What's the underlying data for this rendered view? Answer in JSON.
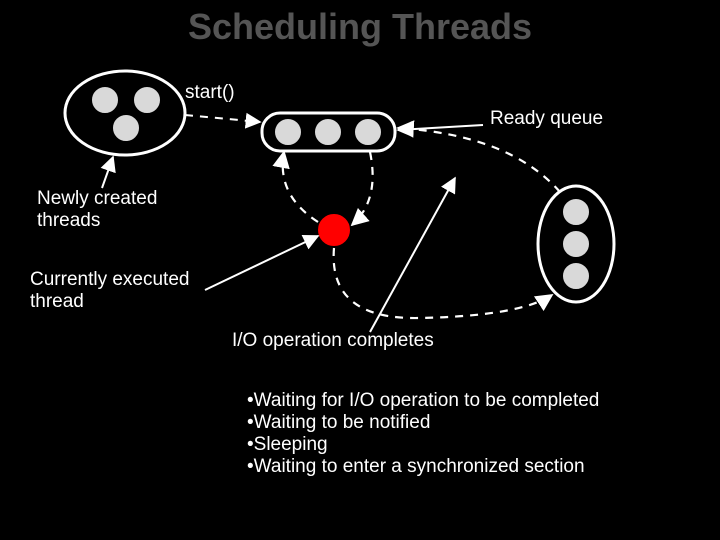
{
  "title": "Scheduling Threads",
  "labels": {
    "start": "start()",
    "readyQueue": "Ready queue",
    "newlyCreated": "Newly created\nthreads",
    "currentlyExecuted": "Currently executed\nthread",
    "ioCompletes": "I/O operation completes"
  },
  "bullets": [
    "Waiting for I/O operation to be completed",
    "Waiting to be notified",
    "Sleeping",
    "Waiting to enter a synchronized section"
  ]
}
